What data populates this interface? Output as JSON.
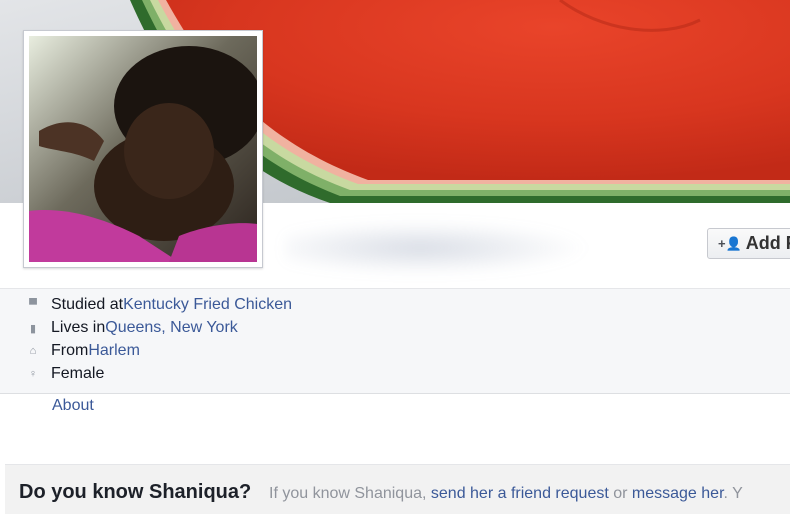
{
  "profile": {
    "add_friend_label": "Add F",
    "add_icon": "add-friend-icon"
  },
  "intro": {
    "studied": {
      "prefix": "Studied at ",
      "link": "Kentucky Fried Chicken",
      "icon": "education-icon"
    },
    "lives": {
      "prefix": "Lives in ",
      "link": "Queens, New York",
      "icon": "city-icon"
    },
    "from": {
      "prefix": "From ",
      "link": "Harlem",
      "icon": "home-icon"
    },
    "gender": {
      "text": "Female",
      "icon": "female-icon"
    }
  },
  "nav": {
    "about_label": "About"
  },
  "friend_prompt": {
    "title": "Do you know Shaniqua?",
    "text_before": "If you know Shaniqua, ",
    "link1": "send her a friend request",
    "text_middle": " or ",
    "link2": "message her",
    "text_after": ". Y"
  },
  "colors": {
    "link": "#3b5998",
    "watermelon": "#d6371f",
    "rind": "#3f7a3a"
  }
}
